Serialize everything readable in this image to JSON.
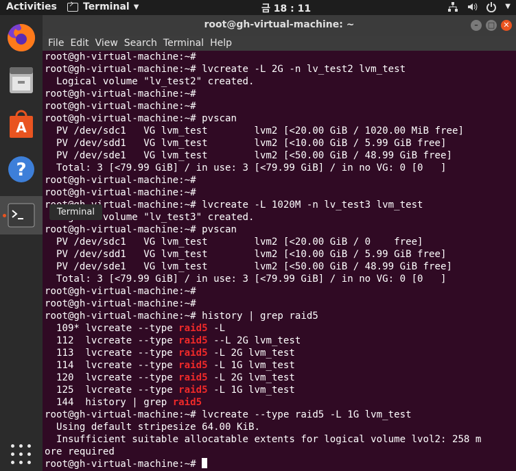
{
  "topbar": {
    "activities": "Activities",
    "app_name": "Terminal",
    "clock": "금 18 : 11",
    "tray": [
      "network-icon",
      "volume-icon",
      "power-icon"
    ]
  },
  "dock": {
    "items": [
      "firefox",
      "files",
      "ubuntu-software",
      "help",
      "terminal"
    ],
    "tooltip": "Terminal",
    "active_accent": "#e95420"
  },
  "window": {
    "title": "root@gh-virtual-machine: ~",
    "menu": [
      "File",
      "Edit",
      "View",
      "Search",
      "Terminal",
      "Help"
    ],
    "colors": {
      "background": "#300a24",
      "highlight": "#ef2929"
    }
  },
  "terminal": {
    "lines": [
      [
        {
          "t": "root@gh-virtual-machine:~#"
        }
      ],
      [
        {
          "t": "root@gh-virtual-machine:~# lvcreate -L 2G -n lv_test2 lvm_test"
        }
      ],
      [
        {
          "t": "  Logical volume \"lv_test2\" created."
        }
      ],
      [
        {
          "t": "root@gh-virtual-machine:~#"
        }
      ],
      [
        {
          "t": "root@gh-virtual-machine:~#"
        }
      ],
      [
        {
          "t": "root@gh-virtual-machine:~# pvscan"
        }
      ],
      [
        {
          "t": "  PV /dev/sdc1   VG lvm_test        lvm2 [<20.00 GiB / 1020.00 MiB free]"
        }
      ],
      [
        {
          "t": "  PV /dev/sdd1   VG lvm_test        lvm2 [<10.00 GiB / 5.99 GiB free]"
        }
      ],
      [
        {
          "t": "  PV /dev/sde1   VG lvm_test        lvm2 [<50.00 GiB / 48.99 GiB free]"
        }
      ],
      [
        {
          "t": "  Total: 3 [<79.99 GiB] / in use: 3 [<79.99 GiB] / in no VG: 0 [0   ]"
        }
      ],
      [
        {
          "t": "root@gh-virtual-machine:~#"
        }
      ],
      [
        {
          "t": "root@gh-virtual-machine:~#"
        }
      ],
      [
        {
          "t": "root@gh-virtual-machine:~# lvcreate -L 1020M -n lv_test3 lvm_test"
        }
      ],
      [
        {
          "t": "  Logical volume \"lv_test3\" created."
        }
      ],
      [
        {
          "t": "root@gh-virtual-machine:~# pvscan"
        }
      ],
      [
        {
          "t": "  PV /dev/sdc1   VG lvm_test        lvm2 [<20.00 GiB / 0    free]"
        }
      ],
      [
        {
          "t": "  PV /dev/sdd1   VG lvm_test        lvm2 [<10.00 GiB / 5.99 GiB free]"
        }
      ],
      [
        {
          "t": "  PV /dev/sde1   VG lvm_test        lvm2 [<50.00 GiB / 48.99 GiB free]"
        }
      ],
      [
        {
          "t": "  Total: 3 [<79.99 GiB] / in use: 3 [<79.99 GiB] / in no VG: 0 [0   ]"
        }
      ],
      [
        {
          "t": "root@gh-virtual-machine:~#"
        }
      ],
      [
        {
          "t": "root@gh-virtual-machine:~#"
        }
      ],
      [
        {
          "t": "root@gh-virtual-machine:~# history | grep raid5"
        }
      ],
      [
        {
          "t": "  109* lvcreate --type "
        },
        {
          "t": "raid5",
          "hl": true
        },
        {
          "t": " -L"
        }
      ],
      [
        {
          "t": "  112  lvcreate --type "
        },
        {
          "t": "raid5",
          "hl": true
        },
        {
          "t": " --L 2G lvm_test"
        }
      ],
      [
        {
          "t": "  113  lvcreate --type "
        },
        {
          "t": "raid5",
          "hl": true
        },
        {
          "t": " -L 2G lvm_test"
        }
      ],
      [
        {
          "t": "  114  lvcreate --type "
        },
        {
          "t": "raid5",
          "hl": true
        },
        {
          "t": " -L 1G lvm_test"
        }
      ],
      [
        {
          "t": "  120  lvcreate --type "
        },
        {
          "t": "raid5",
          "hl": true
        },
        {
          "t": " -L 2G lvm_test"
        }
      ],
      [
        {
          "t": "  125  lvcreate --type "
        },
        {
          "t": "raid5",
          "hl": true
        },
        {
          "t": " -L 1G lvm_test"
        }
      ],
      [
        {
          "t": "  144  history | grep "
        },
        {
          "t": "raid5",
          "hl": true
        }
      ],
      [
        {
          "t": "root@gh-virtual-machine:~# lvcreate --type raid5 -L 1G lvm_test"
        }
      ],
      [
        {
          "t": "  Using default stripesize 64.00 KiB."
        }
      ],
      [
        {
          "t": "  Insufficient suitable allocatable extents for logical volume lvol2: 258 m"
        }
      ],
      [
        {
          "t": "ore required"
        }
      ],
      [
        {
          "t": "root@gh-virtual-machine:~# "
        },
        {
          "cursor": true
        }
      ]
    ]
  }
}
